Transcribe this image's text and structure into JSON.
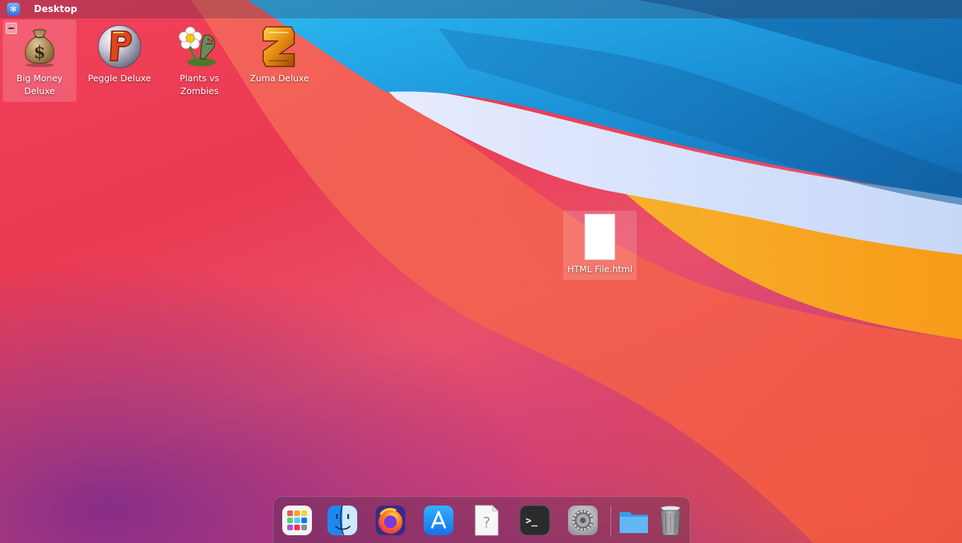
{
  "topbar": {
    "app_icon": "gear-snowflake-icon",
    "title": "Desktop"
  },
  "desktop_icons": [
    {
      "label": "Big Money Deluxe",
      "icon": "money-bag-icon",
      "selected": true
    },
    {
      "label": "Peggle Deluxe",
      "icon": "peggle-ball-icon",
      "selected": false
    },
    {
      "label": "Plants vs Zombies",
      "icon": "flower-zombie-icon",
      "selected": false
    },
    {
      "label": "Zuma Deluxe",
      "icon": "zuma-stone-icon",
      "selected": false
    },
    {
      "label": "HTML File.html",
      "icon": "blank-document-icon",
      "selected": true
    }
  ],
  "dock": {
    "items": [
      {
        "name": "launchpad",
        "icon": "launchpad-grid-icon"
      },
      {
        "name": "finder",
        "icon": "finder-face-icon"
      },
      {
        "name": "firefox",
        "icon": "firefox-icon"
      },
      {
        "name": "app-store",
        "icon": "app-store-icon"
      },
      {
        "name": "unknown-file",
        "icon": "question-document-icon"
      },
      {
        "name": "terminal",
        "icon": "terminal-icon"
      },
      {
        "name": "system-preferences",
        "icon": "gear-icon"
      },
      {
        "name": "files",
        "icon": "folder-icon"
      },
      {
        "name": "trash",
        "icon": "trash-icon"
      }
    ]
  },
  "colors": {
    "wallpaper_red": "#ea3a52",
    "wallpaper_blue": "#1fa0e6",
    "wallpaper_orange": "#f7a41e",
    "wallpaper_purple": "#7d3593"
  }
}
